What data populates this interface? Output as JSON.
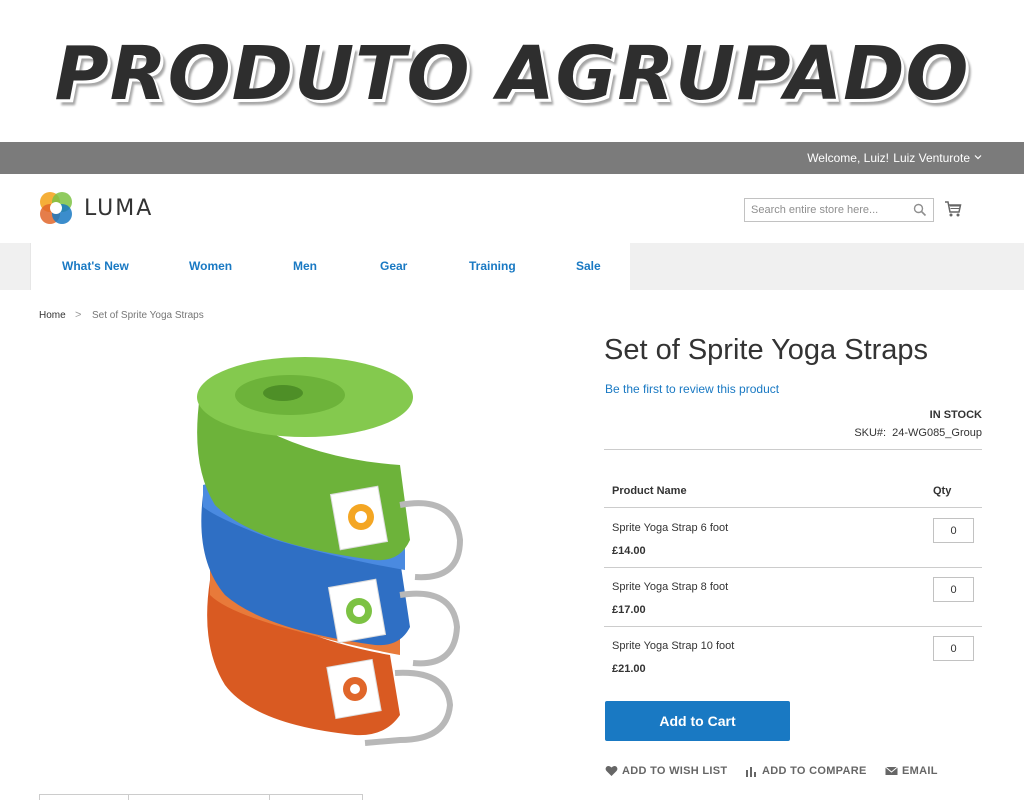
{
  "banner": {
    "title": "PRODUTO AGRUPADO"
  },
  "topbar": {
    "welcome": "Welcome, Luiz!",
    "user": "Luiz Venturote"
  },
  "header": {
    "logo_text": "LUMA",
    "search_placeholder": "Search entire store here..."
  },
  "nav": {
    "items": [
      {
        "label": "What's New"
      },
      {
        "label": "Women"
      },
      {
        "label": "Men"
      },
      {
        "label": "Gear"
      },
      {
        "label": "Training"
      },
      {
        "label": "Sale"
      }
    ]
  },
  "breadcrumb": {
    "home": "Home",
    "separator": ">",
    "current": "Set of Sprite Yoga Straps"
  },
  "product": {
    "title": "Set of Sprite Yoga Straps",
    "review_link": "Be the first to review this product",
    "stock": "IN STOCK",
    "sku_label": "SKU#:",
    "sku": "24-WG085_Group",
    "table": {
      "col_name": "Product Name",
      "col_qty": "Qty",
      "rows": [
        {
          "name": "Sprite Yoga Strap 6 foot",
          "price": "£14.00",
          "qty": "0"
        },
        {
          "name": "Sprite Yoga Strap 8 foot",
          "price": "£17.00",
          "qty": "0"
        },
        {
          "name": "Sprite Yoga Strap 10 foot",
          "price": "£21.00",
          "qty": "0"
        }
      ]
    },
    "add_to_cart": "Add to Cart",
    "actions": {
      "wishlist": "ADD TO WISH LIST",
      "compare": "ADD TO COMPARE",
      "email": "EMAIL"
    }
  },
  "colors": {
    "accent": "#1979c3",
    "topbar": "#7b7b7b",
    "strap_green": "#7cc243",
    "strap_blue": "#3a7fd1",
    "strap_orange": "#e0662a"
  }
}
